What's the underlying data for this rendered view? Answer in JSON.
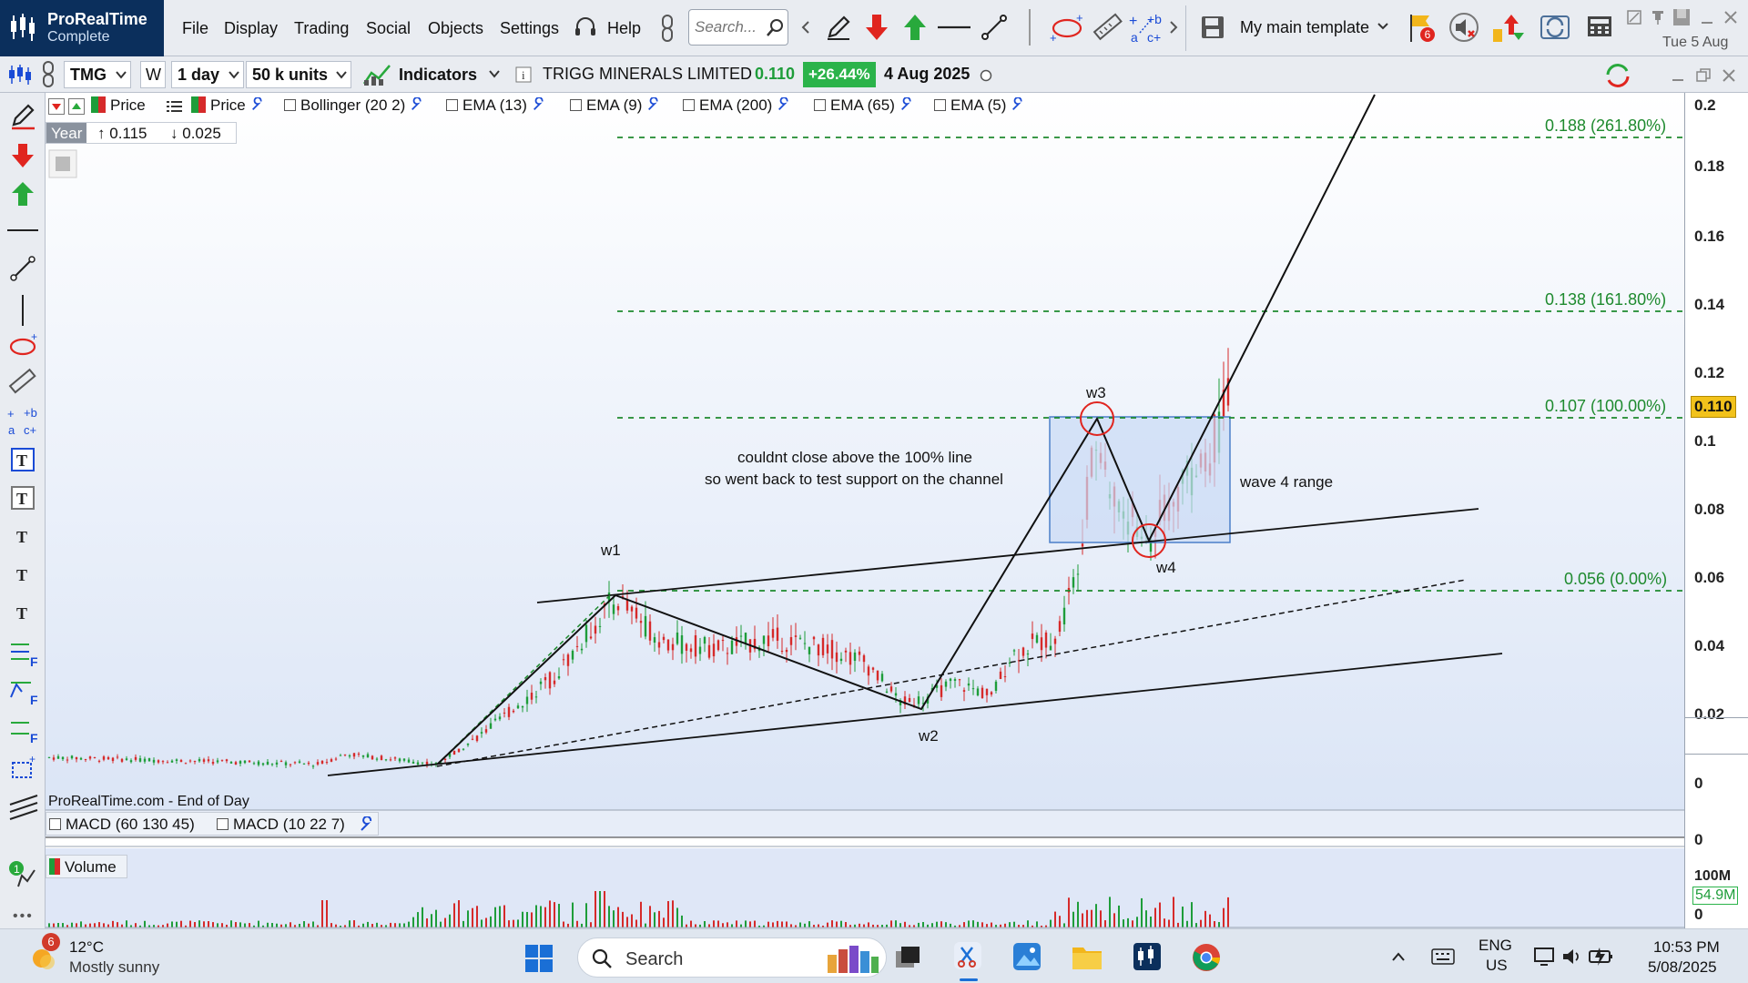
{
  "app": {
    "name": "ProRealTime",
    "edition": "Complete",
    "date_display": "Tue 5 Aug",
    "template": "My main template",
    "alert_badge": "6"
  },
  "menu": [
    "File",
    "Display",
    "Trading",
    "Social",
    "Objects",
    "Settings"
  ],
  "help_label": "Help",
  "search": {
    "placeholder": "Search..."
  },
  "chart_toolbar": {
    "ticker": "TMG",
    "period_code": "W",
    "period": "1 day",
    "units": "50 k units",
    "indicators_label": "Indicators",
    "instrument": "TRIGG MINERALS LIMITED",
    "last_price": "0.110",
    "change": "+26.44%",
    "date": "4 Aug 2025"
  },
  "overlays": [
    "Price",
    "Price",
    "Bollinger (20 2)",
    "EMA (13)",
    "EMA (9)",
    "EMA (200)",
    "EMA (65)",
    "EMA (5)"
  ],
  "info_panel": {
    "scale": "Year",
    "high": "0.115",
    "low": "0.025"
  },
  "price_axis": [
    "0.2",
    "0.18",
    "0.16",
    "0.14",
    "0.12",
    "0.1",
    "0.08",
    "0.06",
    "0.04",
    "0.02",
    "0"
  ],
  "price_tag": "0.110",
  "fib_levels": [
    {
      "label": "0.188 (261.80%)",
      "price": 0.188
    },
    {
      "label": "0.138 (161.80%)",
      "price": 0.138
    },
    {
      "label": "0.107 (100.00%)",
      "price": 0.107
    },
    {
      "label": "0.056 (0.00%)",
      "price": 0.056
    }
  ],
  "annotations": {
    "note_line1": "couldnt close above the 100% line",
    "note_line2": "so went back to test support on the channel",
    "wave4_range": "wave 4 range",
    "w1": "w1",
    "w2": "w2",
    "w3": "w3",
    "w4": "w4"
  },
  "source": "ProRealTime.com - End of Day",
  "macd_pane": {
    "items": [
      "MACD (60 130 45)",
      "MACD (10 22 7)"
    ],
    "axis": "0"
  },
  "volume_pane": {
    "label": "Volume",
    "axis_top": "100M",
    "axis_bottom": "0",
    "tag": "54.9M"
  },
  "taskbar": {
    "weather_temp": "12°C",
    "weather_desc": "Mostly sunny",
    "weather_badge": "6",
    "search_label": "Search",
    "lang": "ENG",
    "region": "US",
    "time": "10:53 PM",
    "date": "5/08/2025"
  },
  "colors": {
    "brand": "#0b2f5c",
    "up": "#1e9d3a",
    "down": "#d62a2a",
    "fib": "#1e8a2e",
    "range_box": "#cfe0f7",
    "chart_bg_gradient_end": "#dde6f6"
  }
}
